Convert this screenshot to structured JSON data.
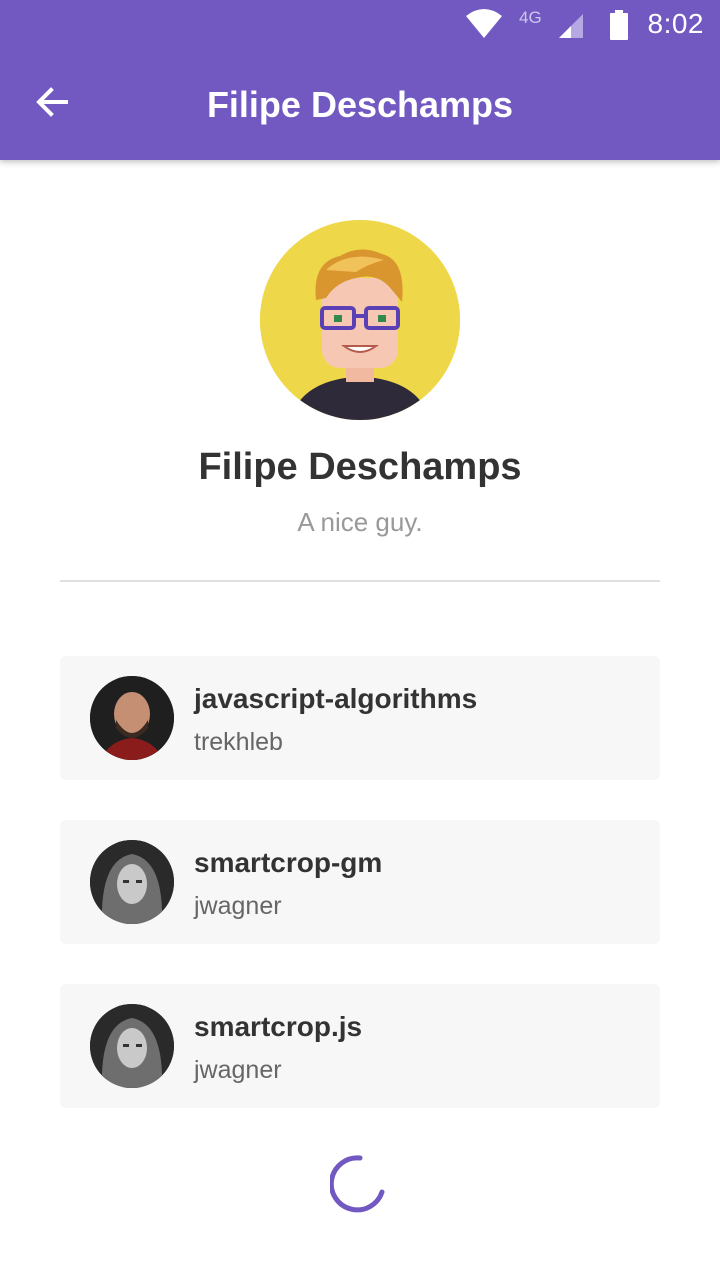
{
  "status_bar": {
    "time": "8:02",
    "network": "4G",
    "icons": [
      "wifi-icon",
      "signal-icon",
      "battery-icon"
    ]
  },
  "toolbar": {
    "title": "Filipe Deschamps",
    "back_icon": "arrow-left-icon"
  },
  "profile": {
    "name": "Filipe Deschamps",
    "bio": "A nice guy."
  },
  "repositories": [
    {
      "name": "javascript-algorithms",
      "owner": "trekhleb"
    },
    {
      "name": "smartcrop-gm",
      "owner": "jwagner"
    },
    {
      "name": "smartcrop.js",
      "owner": "jwagner"
    }
  ],
  "colors": {
    "primary": "#7159c1",
    "card_background": "#f7f7f7",
    "title_text": "#333333",
    "secondary_text": "#999999"
  }
}
